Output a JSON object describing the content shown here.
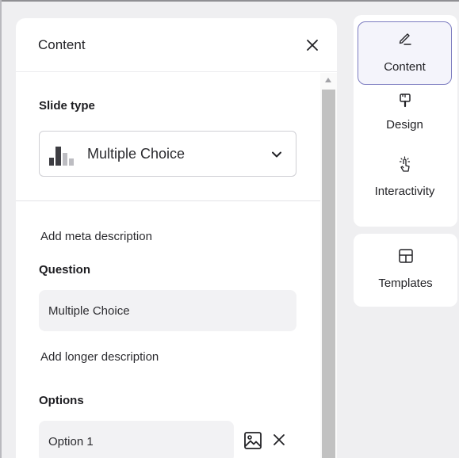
{
  "panel": {
    "title": "Content",
    "slide_type_label": "Slide type",
    "slide_type_value": "Multiple Choice",
    "meta_link": "Add meta description",
    "question_label": "Question",
    "question_value": "Multiple Choice",
    "desc_link": "Add longer description",
    "options_label": "Options",
    "options": [
      "Option 1"
    ]
  },
  "tabs": [
    {
      "label": "Content",
      "icon": "pencil-icon",
      "active": true
    },
    {
      "label": "Design",
      "icon": "paintbrush-icon",
      "active": false
    },
    {
      "label": "Interactivity",
      "icon": "tap-icon",
      "active": false
    }
  ],
  "templates": {
    "label": "Templates",
    "icon": "layout-grid-icon"
  },
  "colors": {
    "accent_border": "#7c7cc0",
    "bar_dark": "#3d3d42",
    "bar_light": "#bdbdc2"
  }
}
